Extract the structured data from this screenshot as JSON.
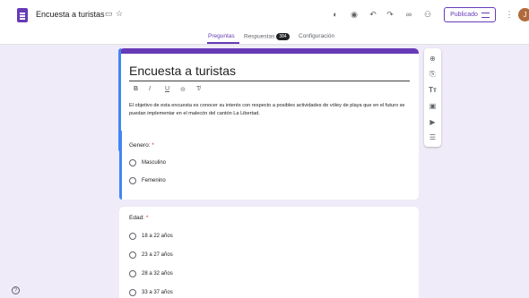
{
  "header": {
    "doc_title": "Encuesta a turistas",
    "publish_label": "Publicado",
    "avatar_initial": "J"
  },
  "tabs": {
    "preguntas": "Preguntas",
    "respuestas": "Respuestas",
    "respuestas_count": "384",
    "configuracion": "Configuración"
  },
  "form": {
    "title": "Encuesta a turistas",
    "format_bold": "B",
    "format_italic": "I",
    "format_underline": "U",
    "format_link": "⊝",
    "format_clear": "T̸",
    "description": "El objetivo de esta encuesta es conocer su interés con respecto a posibles actividades de vóley de playa que en el futuro se puedan implementar en el malecón del cantón La Libertad."
  },
  "questions": [
    {
      "label": "Genero:",
      "required": "*",
      "options": [
        "Masculino",
        "Femenino"
      ]
    },
    {
      "label": "Edad:",
      "required": "*",
      "options": [
        "18 a 22 años",
        "23 a 27 años",
        "28 a 32 años",
        "33 a 37 años"
      ]
    }
  ],
  "colors": {
    "accent": "#673ab7",
    "background": "#f0ebf8",
    "focus": "#4285f4",
    "required": "#d93025"
  }
}
